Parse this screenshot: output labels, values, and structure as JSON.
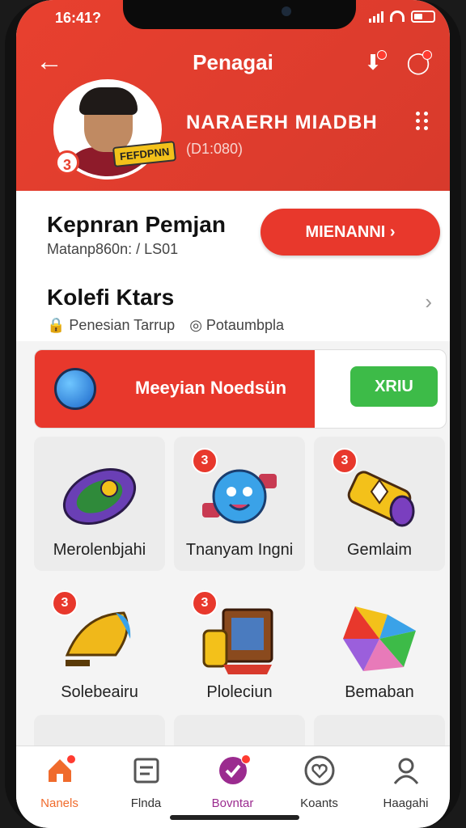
{
  "status_bar": {
    "time": "16:41?"
  },
  "header": {
    "title": "Penagai",
    "profile_name": "NARAERH MIADBH",
    "profile_id": "(D1:080)",
    "avatar_badge": "3",
    "avatar_tag": "FEFDPNN"
  },
  "section1": {
    "title": "Kepnran Pemjan",
    "subtitle": "Matanp860n: / LS01",
    "action_label": "MIENANNI ›"
  },
  "section2": {
    "title": "Kolefi Ktars",
    "meta1": "Penesian Tarrup",
    "meta2": "Potaumbpla"
  },
  "banner": {
    "text": "Meeyian Noedsün",
    "button_label": "XRIU"
  },
  "tiles": [
    {
      "label": "Merolenbjahi",
      "badge": ""
    },
    {
      "label": "Tnanyam Ingni",
      "badge": "3"
    },
    {
      "label": "Gemlaim",
      "badge": "3"
    },
    {
      "label": "Solebeairu",
      "badge": "3"
    },
    {
      "label": "Ploleciun",
      "badge": "3"
    },
    {
      "label": "Bemaban",
      "badge": ""
    }
  ],
  "nav": [
    {
      "label": "Nanels",
      "active": true
    },
    {
      "label": "Flnda",
      "active": false
    },
    {
      "label": "Bovntar",
      "active": false
    },
    {
      "label": "Koants",
      "active": false
    },
    {
      "label": "Haagahi",
      "active": false
    }
  ],
  "colors": {
    "brand_red": "#e8382c",
    "green": "#3dbb48",
    "nav_active": "#f06b2c",
    "nav_purple": "#9b2b8f"
  }
}
